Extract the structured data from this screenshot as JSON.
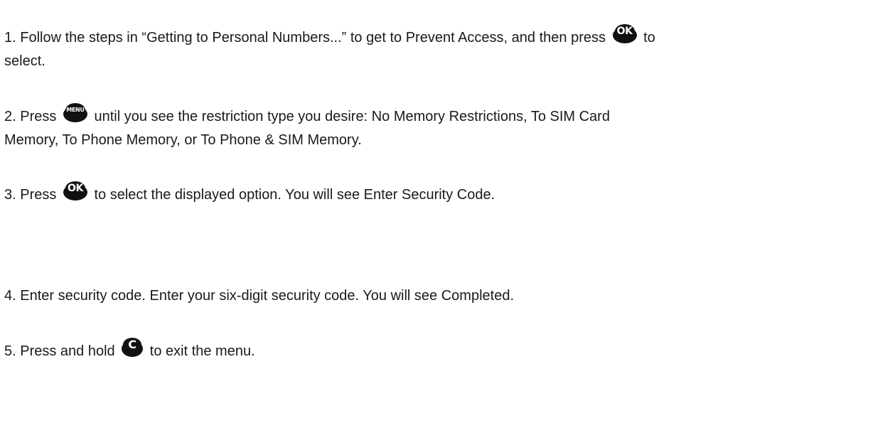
{
  "steps": [
    {
      "part1": "1. Follow the steps in “Getting to Personal Numbers...” to get to Prevent Access, and then press",
      "icon": "ok-button-icon",
      "icon_label": "OK",
      "part2": "to",
      "continuation": "select."
    },
    {
      "part1": "2. Press",
      "icon": "menu-button-icon",
      "icon_label": "MENU",
      "part2": "until you see the restriction type you desire: No Memory Restrictions, To SIM Card",
      "continuation": "Memory, To Phone Memory, or To Phone & SIM Memory."
    },
    {
      "part1": "3. Press",
      "icon": "ok-button-icon",
      "icon_label": "OK",
      "part2": "to select the displayed option. You will see Enter Security Code."
    },
    {
      "text": "4. Enter security code. Enter your six-digit security code. You will see Completed."
    },
    {
      "part1": "5. Press and hold",
      "icon": "clear-button-icon",
      "icon_label": "C",
      "part2": "to exit the menu."
    }
  ]
}
